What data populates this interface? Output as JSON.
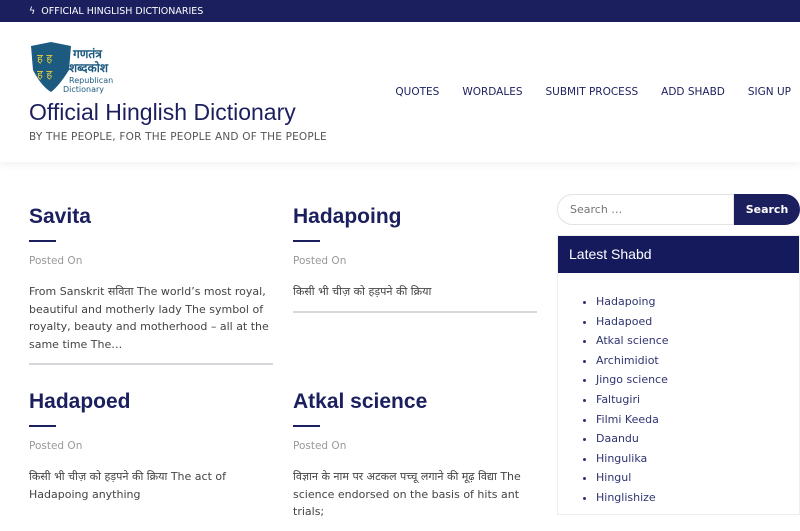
{
  "topbar": {
    "text": "OFFICIAL HINGLISH DICTIONARIES"
  },
  "header": {
    "logo_text": "गणतंत्र शब्दकोश Republican Dictionary",
    "site_title": "Official Hinglish Dictionary",
    "tagline": "BY THE PEOPLE, FOR THE PEOPLE AND OF THE PEOPLE"
  },
  "nav": [
    "QUOTES",
    "WORDALES",
    "SUBMIT PROCESS",
    "ADD SHABD",
    "SIGN UP"
  ],
  "posts": [
    {
      "title": "Savita",
      "meta": "Posted On",
      "excerpt": "From Sanskrit सविता The world’s most royal, beautiful and motherly lady The symbol of royalty, beauty and motherhood – all at the same time The…"
    },
    {
      "title": "Hadapoing",
      "meta": "Posted On",
      "excerpt": "किसी भी चीज़ को हड़पने की क्रिया"
    },
    {
      "title": "Hadapoed",
      "meta": "Posted On",
      "excerpt": "किसी भी चीज़ को हड़पने की क्रिया The act of Hadapoing anything"
    },
    {
      "title": "Atkal science",
      "meta": "Posted On",
      "excerpt": "विज्ञान के नाम पर अटकल पच्चू लगाने की मूढ़ विद्या The science endorsed on the basis of hits ant trials;"
    }
  ],
  "search": {
    "placeholder": "Search …",
    "button": "Search"
  },
  "widget": {
    "title": "Latest Shabd",
    "items": [
      "Hadapoing",
      "Hadapoed",
      "Atkal science",
      "Archimidiot",
      "Jingo science",
      "Faltugiri",
      "Filmi Keeda",
      "Daandu",
      "Hingulika",
      "Hingul",
      "Hinglishize"
    ]
  },
  "colors": {
    "navy": "#1b1f5e"
  }
}
